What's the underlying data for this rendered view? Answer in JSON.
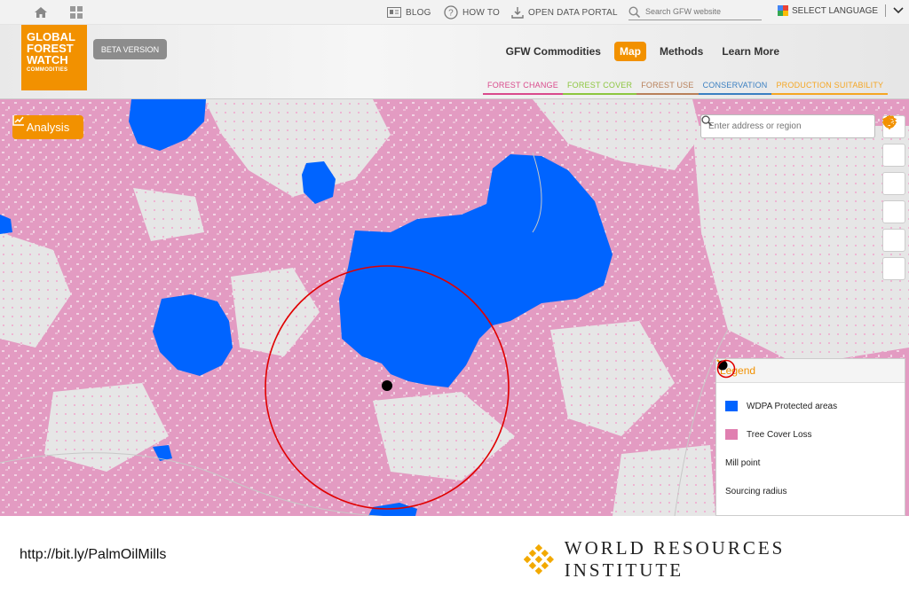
{
  "util_bar": {
    "blog": "BLOG",
    "how_to": "HOW TO",
    "open_data": "OPEN DATA PORTAL",
    "search_placeholder": "Search GFW website",
    "language": "SELECT LANGUAGE"
  },
  "logo": {
    "line1": "GLOBAL",
    "line2": "FOREST",
    "line3": "WATCH",
    "line4": "COMMODITIES"
  },
  "beta": "BETA VERSION",
  "nav": {
    "commodities": "GFW Commodities",
    "map": "Map",
    "methods": "Methods",
    "learn_more": "Learn More"
  },
  "subtabs": {
    "forest_change": "FOREST CHANGE",
    "forest_cover": "FOREST COVER",
    "forest_use": "FOREST USE",
    "conservation": "CONSERVATION",
    "production_suitability": "PRODUCTION SUITABILITY"
  },
  "map": {
    "analysis_label": "Analysis",
    "address_placeholder": "Enter address or region"
  },
  "legend": {
    "title": "Legend",
    "items": [
      {
        "label": "WDPA Protected areas",
        "color": "#0064ff"
      },
      {
        "label": "Tree Cover Loss",
        "color": "#e07fb0"
      },
      {
        "label": "Mill point",
        "color": "#000000"
      },
      {
        "label": "Sourcing radius",
        "color": "#e00000"
      }
    ]
  },
  "footer": {
    "url": "http://bit.ly/PalmOilMills",
    "org": "WORLD RESOURCES INSTITUTE"
  },
  "colors": {
    "accent": "#f29100",
    "protected": "#0064ff",
    "loss": "#e07fb0"
  }
}
